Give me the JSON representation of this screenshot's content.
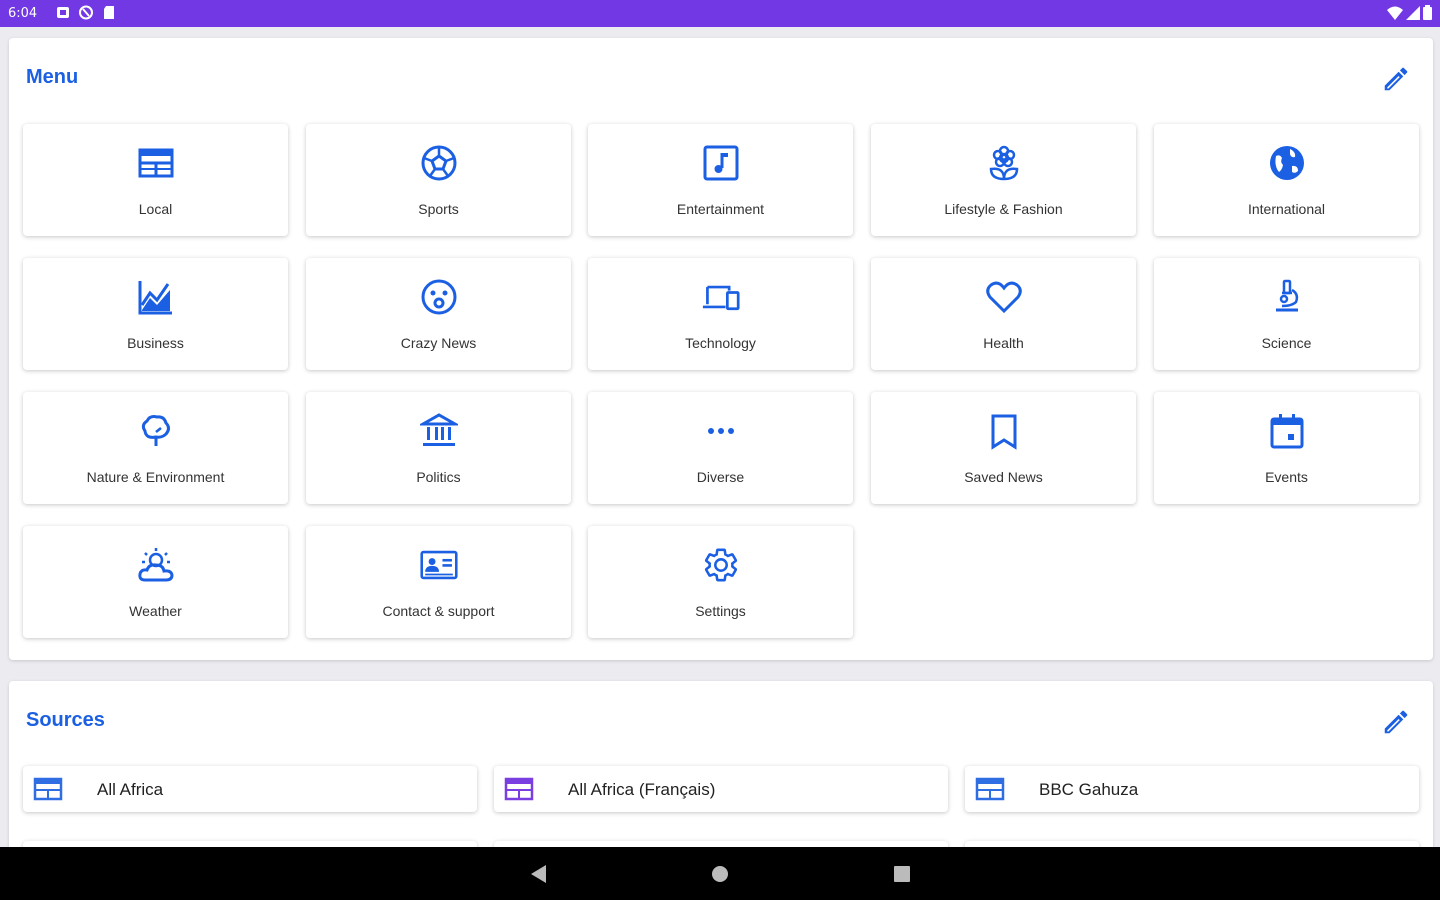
{
  "status_bar": {
    "time": "6:04"
  },
  "menu": {
    "title": "Menu",
    "items": [
      {
        "label": "Local",
        "icon": "newspaper-icon"
      },
      {
        "label": "Sports",
        "icon": "soccer-ball-icon"
      },
      {
        "label": "Entertainment",
        "icon": "music-note-icon"
      },
      {
        "label": "Lifestyle & Fashion",
        "icon": "flower-icon"
      },
      {
        "label": "International",
        "icon": "globe-icon"
      },
      {
        "label": "Business",
        "icon": "chart-icon"
      },
      {
        "label": "Crazy News",
        "icon": "surprised-face-icon"
      },
      {
        "label": "Technology",
        "icon": "devices-icon"
      },
      {
        "label": "Health",
        "icon": "heart-icon"
      },
      {
        "label": "Science",
        "icon": "microscope-icon"
      },
      {
        "label": "Nature & Environment",
        "icon": "tree-icon"
      },
      {
        "label": "Politics",
        "icon": "government-building-icon"
      },
      {
        "label": "Diverse",
        "icon": "more-dots-icon"
      },
      {
        "label": "Saved News",
        "icon": "bookmark-icon"
      },
      {
        "label": "Events",
        "icon": "calendar-icon"
      },
      {
        "label": "Weather",
        "icon": "weather-icon"
      },
      {
        "label": "Contact & support",
        "icon": "contact-card-icon"
      },
      {
        "label": "Settings",
        "icon": "gear-icon"
      }
    ]
  },
  "sources": {
    "title": "Sources",
    "items": [
      {
        "label": "All Africa"
      },
      {
        "label": "All Africa (Français)"
      },
      {
        "label": "BBC Gahuza"
      }
    ]
  },
  "colors": {
    "accent": "#1b5fe3",
    "status_bar": "#7138e3",
    "source_icon_blue": "#2f6de3",
    "source_icon_purple": "#7a3fe0"
  }
}
